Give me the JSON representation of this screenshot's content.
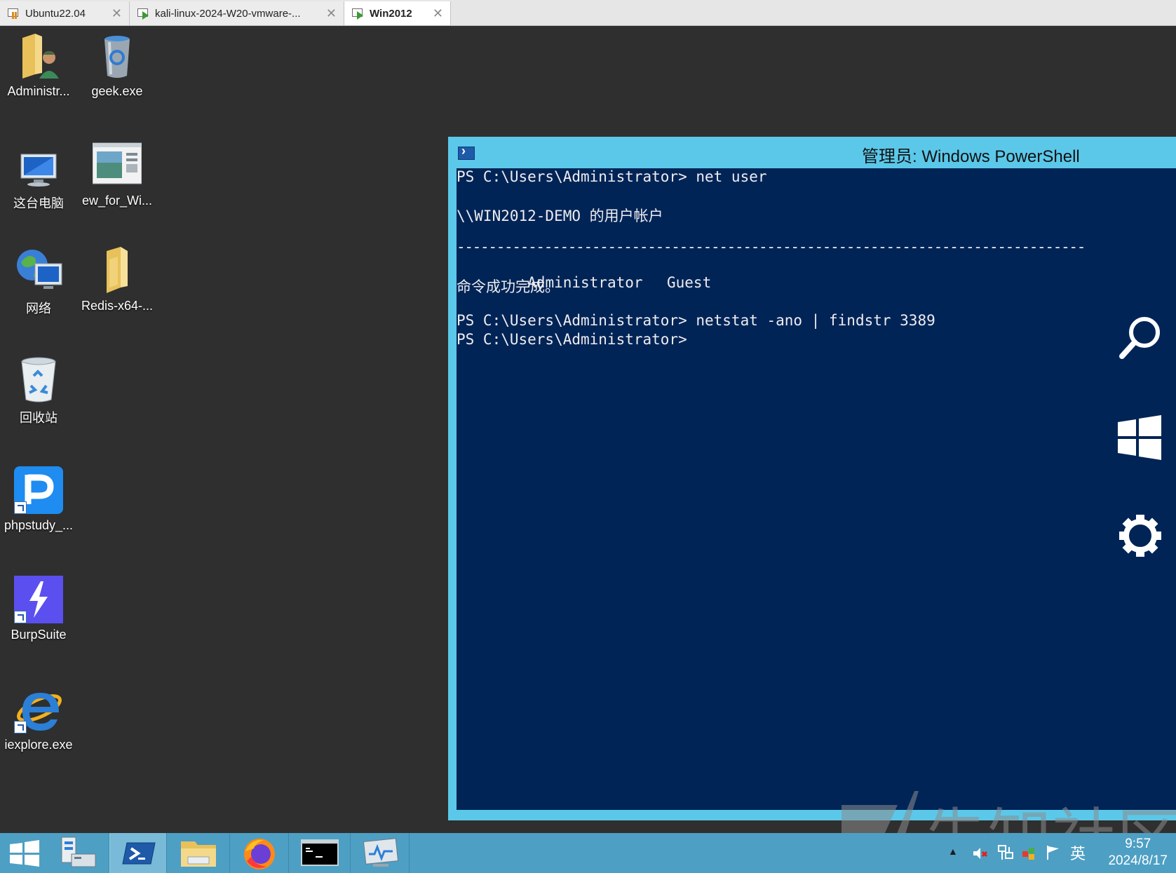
{
  "vm_tabs": [
    {
      "label": "Ubuntu22.04",
      "active": false
    },
    {
      "label": "kali-linux-2024-W20-vmware-...",
      "active": false
    },
    {
      "label": "Win2012",
      "active": true
    }
  ],
  "desktop_icons": [
    {
      "label": "Administr...",
      "icon": "user-folder-icon"
    },
    {
      "label": "geek.exe",
      "icon": "geek-uninstaller-icon"
    },
    {
      "label": "这台电脑",
      "icon": "computer-icon"
    },
    {
      "label": "ew_for_Wi...",
      "icon": "window-file-icon"
    },
    {
      "label": "网络",
      "icon": "network-icon"
    },
    {
      "label": "Redis-x64-...",
      "icon": "folder-icon"
    },
    {
      "label": "回收站",
      "icon": "recycle-bin-icon"
    },
    {
      "label": "phpstudy_...",
      "icon": "phpstudy-icon"
    },
    {
      "label": "BurpSuite",
      "icon": "burpsuite-icon"
    },
    {
      "label": "iexplore.exe",
      "icon": "internet-explorer-icon"
    }
  ],
  "powershell": {
    "title": "管理员: Windows PowerShell",
    "lines": {
      "l1": "PS C:\\Users\\Administrator> net user",
      "l2": "\\\\WIN2012-DEMO 的用户帐户",
      "l3": "-------------------------------------------------------------------------------",
      "l4_a": "Administrator",
      "l4_b": "Guest",
      "l5": "命令成功完成。",
      "l6": "PS C:\\Users\\Administrator> netstat -ano | findstr 3389",
      "l7": "PS C:\\Users\\Administrator>"
    },
    "bg_color": "#012456",
    "frame_color": "#5bc8ea"
  },
  "charms": [
    "search-icon",
    "windows-start-icon",
    "settings-gear-icon"
  ],
  "taskbar": {
    "items": [
      "start-button",
      "server-manager",
      "powershell",
      "file-explorer",
      "firefox",
      "cmd",
      "performance-monitor"
    ],
    "tray": {
      "ime": "英",
      "time": "9:57",
      "date": "2024/8/17"
    },
    "color": "#4e9fc4"
  },
  "watermark": "先知社区"
}
